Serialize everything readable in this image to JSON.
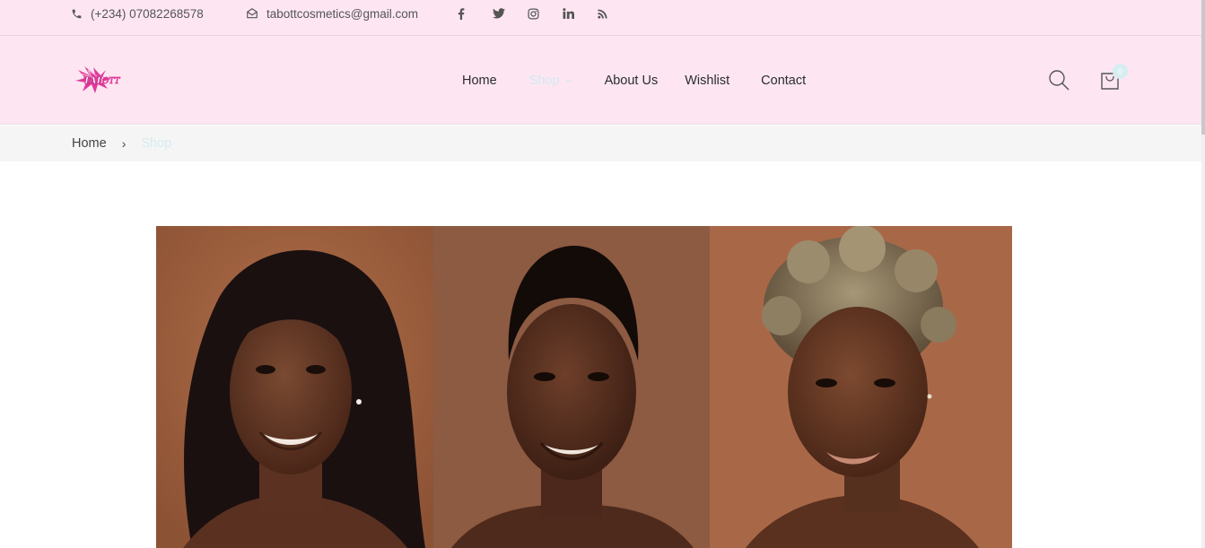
{
  "topbar": {
    "phone": "(+234) 07082268578",
    "email": "tabottcosmetics@gmail.com",
    "socials": [
      "facebook-icon",
      "twitter-icon",
      "instagram-icon",
      "linkedin-icon",
      "rss-icon"
    ]
  },
  "header": {
    "logo_text": "TABOTT",
    "nav": {
      "home": "Home",
      "shop": "Shop",
      "about": "About Us",
      "wishlist": "Wishlist",
      "contact": "Contact"
    },
    "cart_count": "0"
  },
  "breadcrumb": {
    "home": "Home",
    "current": "Shop"
  },
  "colors": {
    "header_bg": "#fde6f2",
    "accent_light": "#d6eef2",
    "breadcrumb_bg": "#f5f5f5"
  },
  "banner": {
    "panels": [
      "portrait-long-hair",
      "portrait-short-hair",
      "portrait-curly-hair"
    ]
  }
}
